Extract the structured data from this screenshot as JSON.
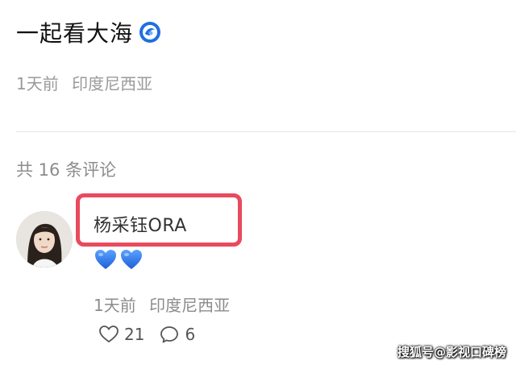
{
  "post": {
    "title": "一起看大海",
    "topic_icon": "ocean-wave-badge-icon",
    "time": "1天前",
    "location": "印度尼西亚"
  },
  "comments_section": {
    "count_label": "共 16 条评论"
  },
  "comment": {
    "username": "杨采钰ORA",
    "highlight_color": "#e94a5d",
    "avatar_icon": "user-avatar",
    "content_emoji": [
      "blue-heart-icon",
      "blue-heart-icon"
    ],
    "time": "1天前",
    "location": "印度尼西亚",
    "likes": "21",
    "replies": "6"
  },
  "watermark": "搜狐号@影视口碑榜",
  "colors": {
    "accent_blue": "#1f6fe0",
    "meta_gray": "#8c8c8c"
  }
}
